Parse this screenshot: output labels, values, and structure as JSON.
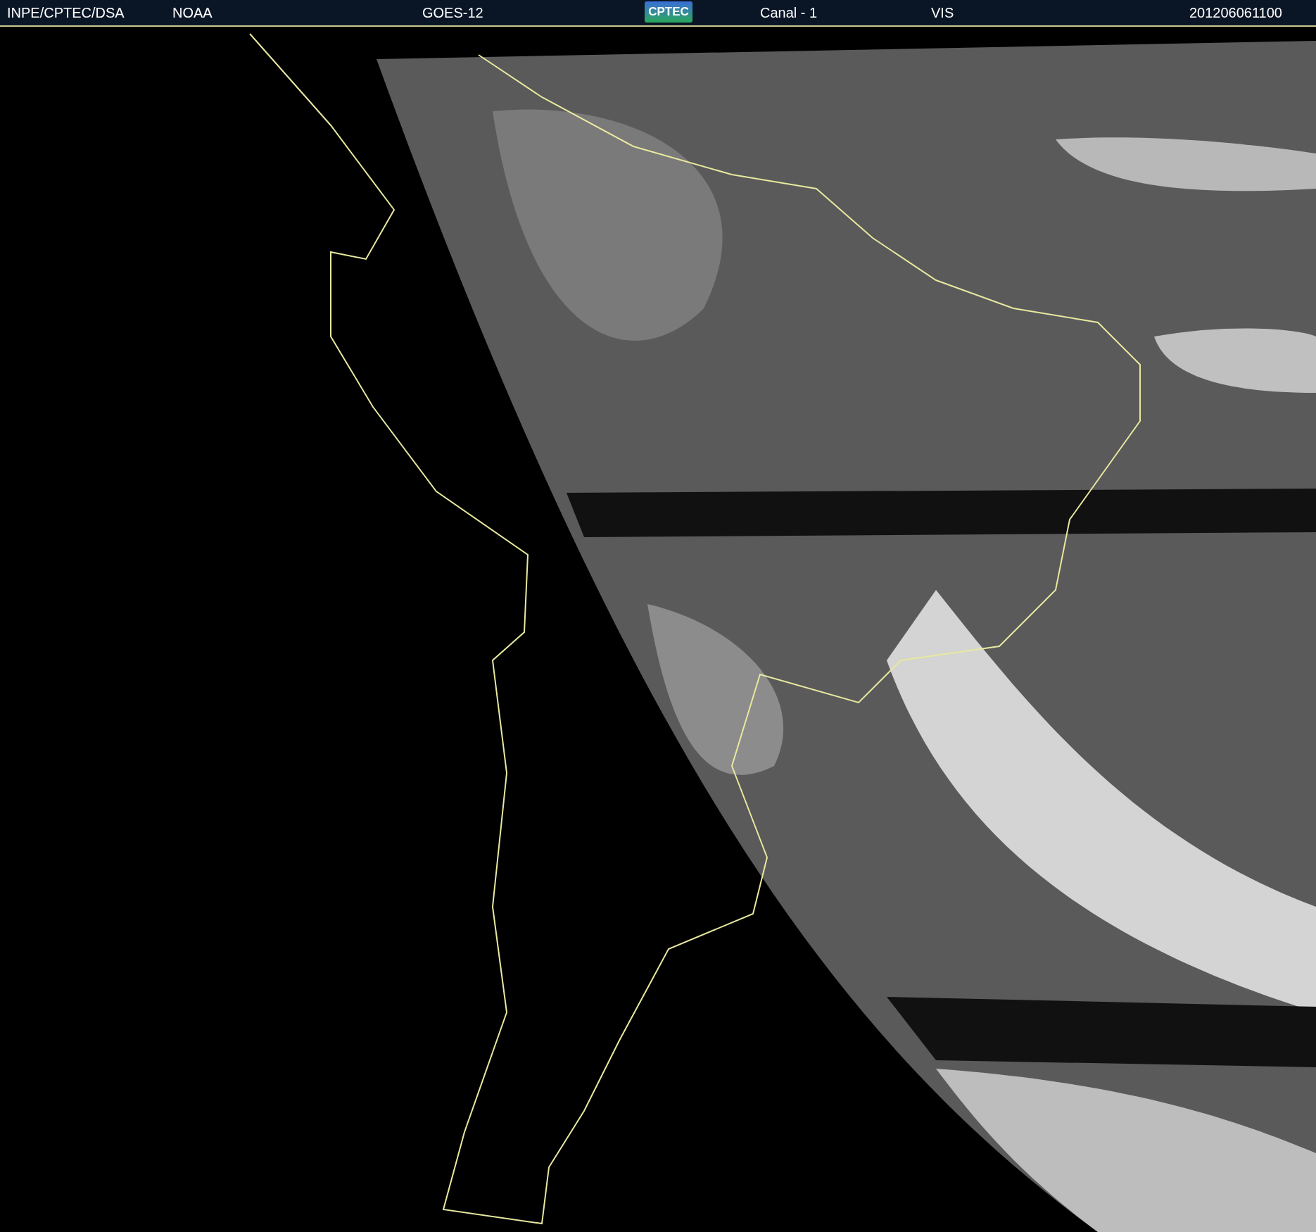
{
  "header": {
    "items": [
      {
        "kind": "text",
        "text": "INPE/CPTEC/DSA"
      },
      {
        "kind": "text",
        "text": "NOAA"
      },
      {
        "kind": "text",
        "text": "GOES-12"
      },
      {
        "kind": "logo",
        "text": "CPTEC"
      },
      {
        "kind": "text",
        "text": "Canal - 1"
      },
      {
        "kind": "text",
        "text": "VIS"
      },
      {
        "kind": "text",
        "text": "201206061100"
      }
    ]
  }
}
